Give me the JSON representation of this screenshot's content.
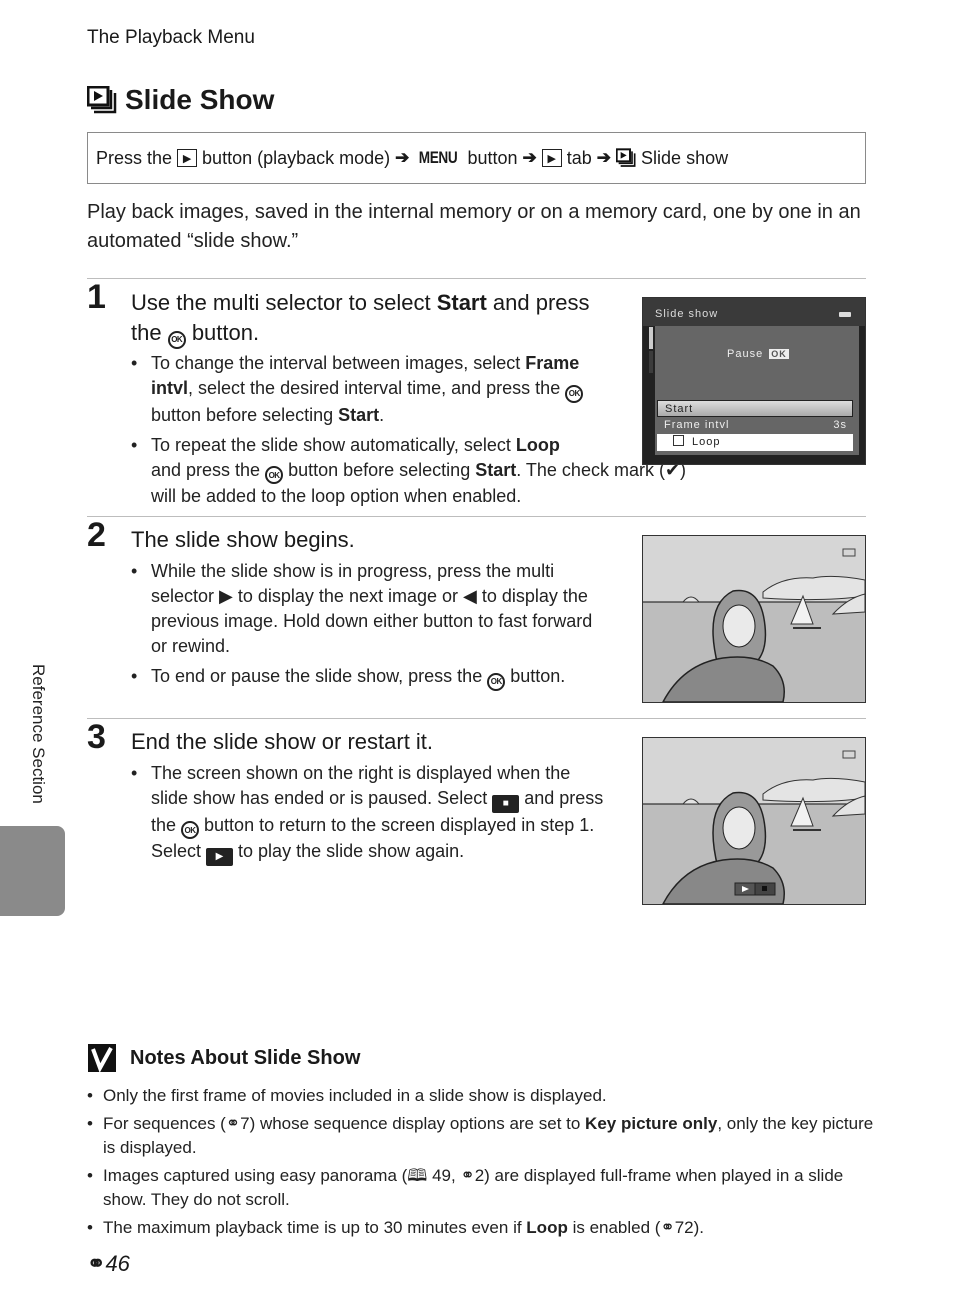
{
  "running_head": "The Playback Menu",
  "title": {
    "icon": "slideshow-icon",
    "text": "Slide Show"
  },
  "nav_path": {
    "prefix": "Press the",
    "seg1": "button (playback mode)",
    "menu_word": "MENU",
    "seg2": "button",
    "seg3": "tab",
    "seg4": "Slide show",
    "arrow": "➔"
  },
  "intro": "Play back images, saved in the internal memory or on a memory card, one by one in an automated “slide show.”",
  "steps": [
    {
      "number": "1",
      "title_pre": "Use the multi selector to select ",
      "title_bold": "Start",
      "title_mid": " and press the ",
      "title_post": " button.",
      "bullets": [
        {
          "t1": "To change the interval between images, select ",
          "b1": "Frame intvl",
          "t2": ", select the desired interval time, and press the ",
          "t3": " button before selecting ",
          "b2": "Start",
          "t4": "."
        },
        {
          "t1": "To repeat the slide show automatically, select ",
          "b1": "Loop",
          "t2": " and press the ",
          "t3": " button before selecting ",
          "b2": "Start",
          "t4": ". The check mark (",
          "t5": ") will be added to the loop option when enabled."
        }
      ]
    },
    {
      "number": "2",
      "title": "The slide show begins.",
      "bullets": [
        {
          "t1": "While the slide show is in progress, press the multi selector ",
          "t2": " to display the next image or ",
          "t3": " to display the previous image. Hold down either button to fast forward or rewind."
        },
        {
          "t1": "To end or pause the slide show, press the ",
          "t2": " button."
        }
      ]
    },
    {
      "number": "3",
      "title": "End the slide show or restart it.",
      "bullets": [
        {
          "t1": "The screen shown on the right is displayed when the slide show has ended or is paused. Select ",
          "t2": " and press the ",
          "t3": " button to return to the screen displayed in step 1. Select ",
          "t4": " to play the slide show again."
        }
      ]
    }
  ],
  "camera_menu": {
    "header": "Slide show",
    "pause_label": "Pause",
    "ok_label": "OK",
    "items": [
      {
        "label": "Start",
        "value": ""
      },
      {
        "label": "Frame intvl",
        "value": "3s"
      },
      {
        "label": "Loop",
        "value": "",
        "checked": false
      }
    ]
  },
  "ok_glyph": "OK",
  "side_label": "Reference Section",
  "notes": {
    "title": "Notes About Slide Show",
    "items": [
      {
        "t1": "Only the first frame of movies included in a slide show is displayed."
      },
      {
        "t1": "For sequences (",
        "r1": "7",
        "t2": ") whose sequence display options are set to ",
        "b1": "Key picture only",
        "t3": ", only the key picture is displayed."
      },
      {
        "t1": "Images captured using easy panorama (",
        "r1": " 49, ",
        "r2": "2",
        "t2": ") are displayed full-frame when played in a slide show. They do not scroll."
      },
      {
        "t1": "The maximum playback time is up to 30 minutes even if ",
        "b1": "Loop",
        "t2": " is enabled (",
        "r1": "72",
        "t3": ")."
      }
    ]
  },
  "page_number": "46"
}
